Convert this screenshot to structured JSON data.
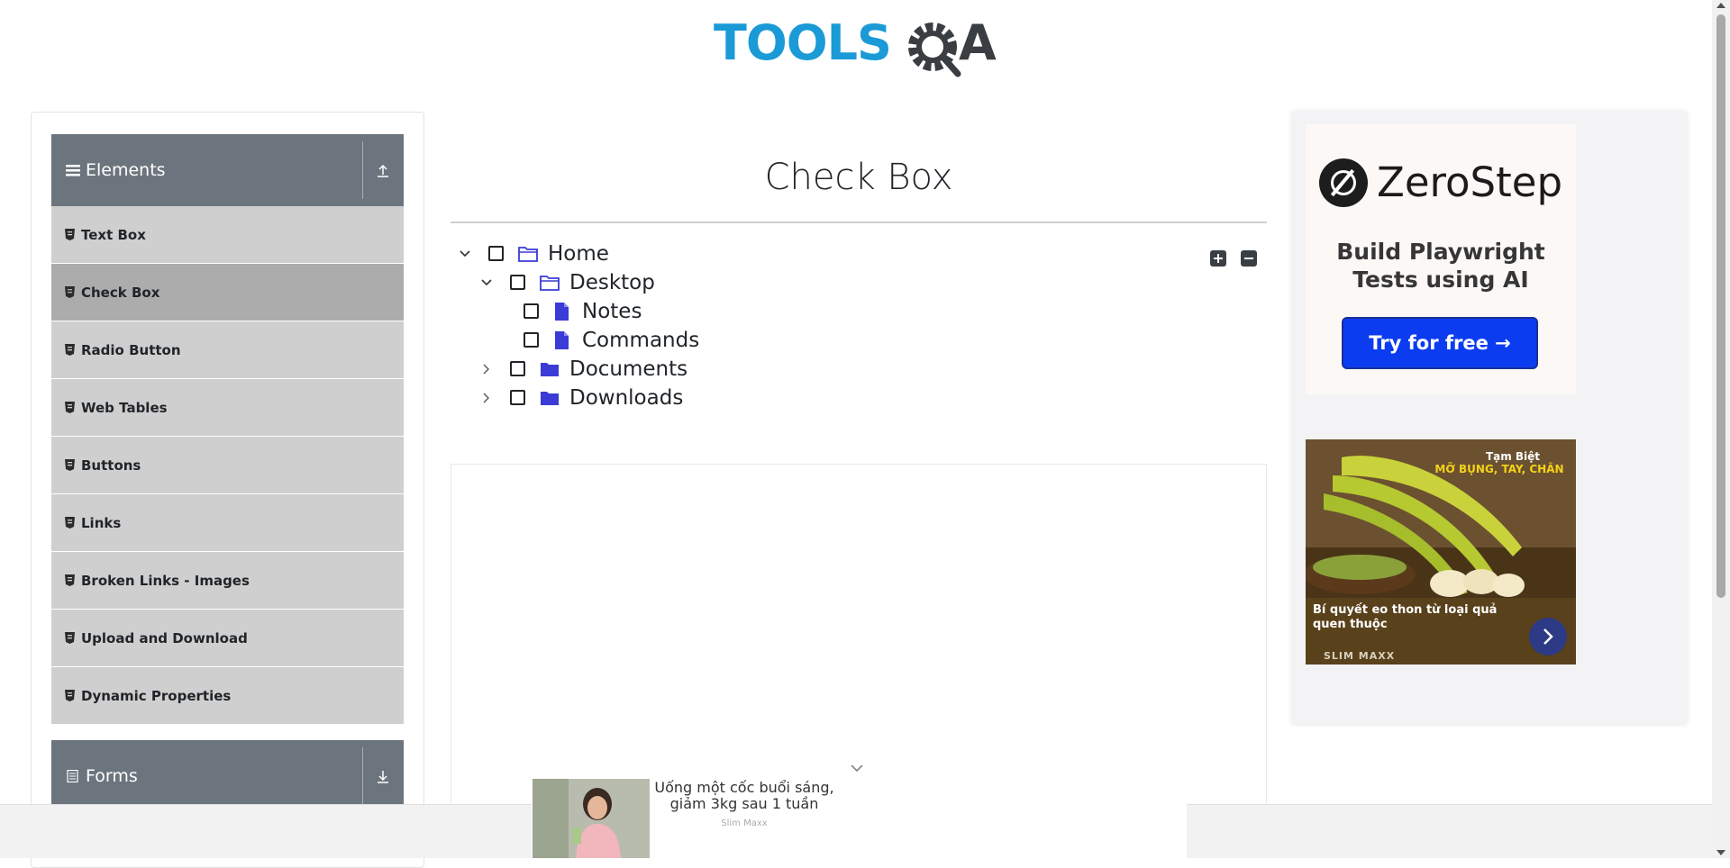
{
  "header": {
    "logo_text": "TOOLS",
    "logo_suffix": "A"
  },
  "sidebar": {
    "group_elements": {
      "label": "Elements"
    },
    "items": [
      {
        "label": "Text Box"
      },
      {
        "label": "Check Box"
      },
      {
        "label": "Radio Button"
      },
      {
        "label": "Web Tables"
      },
      {
        "label": "Buttons"
      },
      {
        "label": "Links"
      },
      {
        "label": "Broken Links - Images"
      },
      {
        "label": "Upload and Download"
      },
      {
        "label": "Dynamic Properties"
      }
    ],
    "active_item": "Check Box",
    "group_forms": {
      "label": "Forms"
    }
  },
  "main": {
    "title": "Check Box",
    "tree": {
      "home": "Home",
      "desktop": "Desktop",
      "notes": "Notes",
      "commands": "Commands",
      "documents": "Documents",
      "downloads": "Downloads"
    }
  },
  "ads": {
    "zerostep": {
      "name": "ZeroStep",
      "tagline_1": "Build Playwright",
      "tagline_2": "Tests using AI",
      "cta": "Try for free →"
    },
    "banana": {
      "badge_1": "Tạm Biệt",
      "badge_2": "MỠ BỤNG, TAY, CHÂN",
      "text": "Bí quyết eo thon từ loại quả quen thuộc",
      "brand": "SLIM MAXX"
    },
    "bottom": {
      "title": "Uống một cốc buổi sáng, giảm 3kg sau 1 tuần",
      "brand": "Slim Maxx"
    }
  },
  "colors": {
    "brand_blue": "#1a9ad6",
    "sidebar_header": "#6c757d",
    "sidebar_item": "#cfcfcf",
    "sidebar_item_active": "#acacac",
    "folder_icon": "#3b3bd6",
    "cta_blue": "#0c3cf0"
  }
}
